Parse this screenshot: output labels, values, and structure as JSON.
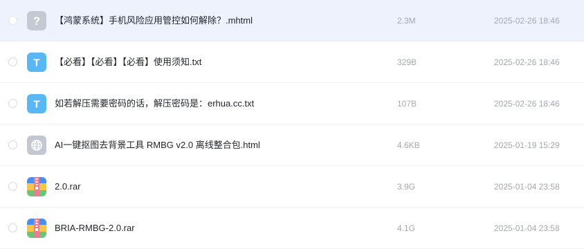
{
  "files": [
    {
      "name": "【鸿蒙系统】手机风险应用管控如何解除？.mhtml",
      "size": "2.3M",
      "date": "2025-02-26 18:46",
      "icon": "unknown-file-icon",
      "selected": true
    },
    {
      "name": "【必看】【必看】【必看】使用须知.txt",
      "size": "329B",
      "date": "2025-02-26 18:46",
      "icon": "text-file-icon",
      "icon_letter": "T",
      "selected": false
    },
    {
      "name": "如若解压需要密码的话，解压密码是：erhua.cc.txt",
      "size": "107B",
      "date": "2025-02-26 18:46",
      "icon": "text-file-icon",
      "icon_letter": "T",
      "selected": false
    },
    {
      "name": "AI一键抠图去背景工具 RMBG v2.0 离线整合包.html",
      "size": "4.6KB",
      "date": "2025-01-19 15:29",
      "icon": "web-file-icon",
      "selected": false
    },
    {
      "name": "2.0.rar",
      "size": "3.9G",
      "date": "2025-01-04 23:58",
      "icon": "archive-file-icon",
      "selected": false
    },
    {
      "name": "BRIA-RMBG-2.0.rar",
      "size": "4.1G",
      "date": "2025-01-04 23:58",
      "icon": "archive-file-icon",
      "selected": false
    }
  ],
  "colors": {
    "selected_row_bg": "#eef2fd",
    "text_icon": "#5ab7f5",
    "unknown_icon": "#c5c9d2",
    "web_icon": "#c3c8d0",
    "archive_blue": "#4a8ef0",
    "archive_pink": "#ee7b8f",
    "archive_yellow": "#f7c54a",
    "archive_green": "#6cc47a"
  }
}
